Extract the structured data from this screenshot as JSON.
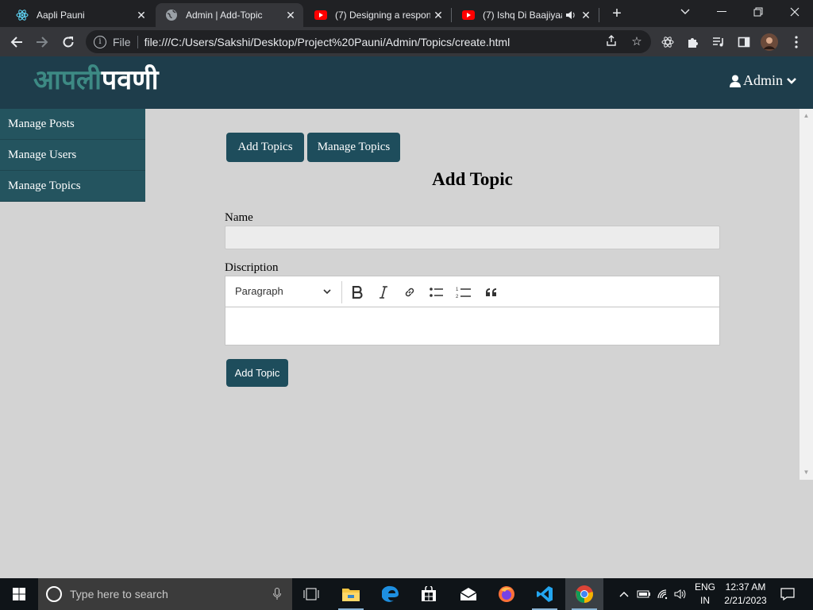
{
  "browser": {
    "tabs": [
      {
        "title": "Aapli Pauni",
        "icon": "react-icon",
        "active": false
      },
      {
        "title": "Admin | Add-Topic",
        "icon": "globe-icon",
        "active": true
      },
      {
        "title": "(7) Designing a respon",
        "icon": "youtube-icon",
        "active": false
      },
      {
        "title": "(7) Ishq Di Baajiyaa",
        "icon": "youtube-icon",
        "active": false
      }
    ],
    "address": {
      "scheme_label": "File",
      "url": "file:///C:/Users/Sakshi/Desktop/Project%20Pauni/Admin/Topics/create.html"
    }
  },
  "site": {
    "logo_part1": "आपली",
    "logo_part2": "पवणी",
    "admin_label": "Admin",
    "colors": {
      "header": "#1e3d4b",
      "sidebar": "#24545f",
      "button": "#1e4d5c",
      "logo_accent": "#3d8a84"
    }
  },
  "sidebar": {
    "items": [
      {
        "label": "Manage Posts"
      },
      {
        "label": "Manage Users"
      },
      {
        "label": "Manage Topics"
      }
    ]
  },
  "main": {
    "buttons": {
      "add_topics": "Add Topics",
      "manage_topics": "Manage Topics"
    },
    "title": "Add Topic",
    "form": {
      "name_label": "Name",
      "name_value": "",
      "description_label": "Discription",
      "editor_heading_select": "Paragraph",
      "editor_tools": [
        "bold-icon",
        "italic-icon",
        "link-icon",
        "bulleted-list-icon",
        "numbered-list-icon",
        "quote-icon"
      ],
      "submit_label": "Add Topic"
    }
  },
  "taskbar": {
    "search_placeholder": "Type here to search",
    "language_line1": "ENG",
    "language_line2": "IN",
    "time": "12:37 AM",
    "date": "2/21/2023"
  }
}
